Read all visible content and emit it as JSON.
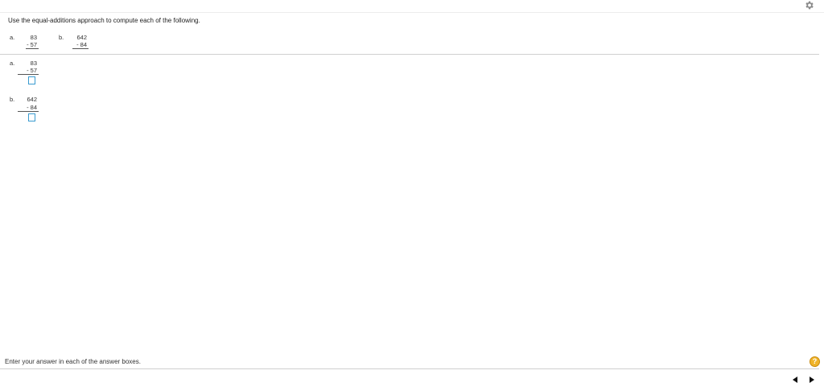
{
  "instruction": "Use the equal-additions approach to compute each of the following.",
  "question_problems": [
    {
      "label": "a.",
      "minuend": "83",
      "subtrahend": "- 57"
    },
    {
      "label": "b.",
      "minuend": "642",
      "subtrahend": "- 84"
    }
  ],
  "answer_problems": [
    {
      "label": "a.",
      "minuend": "83",
      "subtrahend": "- 57",
      "answer_value": ""
    },
    {
      "label": "b.",
      "minuend": "642",
      "subtrahend": "- 84",
      "answer_value": ""
    }
  ],
  "footer": {
    "hint": "Enter your answer in each of the answer boxes.",
    "help_symbol": "?"
  },
  "colors": {
    "answer_box_border": "#3a9bd0",
    "help_badge": "#f0b429"
  },
  "icons": {
    "settings": "gear-icon",
    "help": "help-icon",
    "previous": "previous-arrow-icon",
    "next": "next-arrow-icon"
  }
}
